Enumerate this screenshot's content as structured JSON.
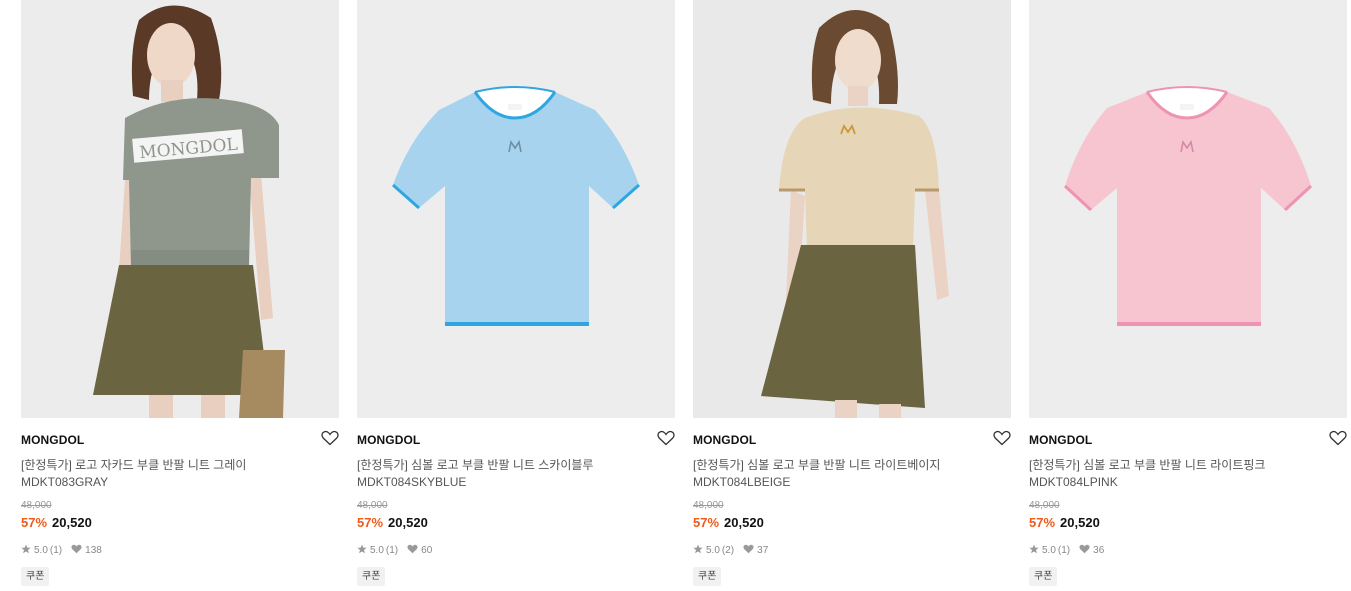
{
  "products": [
    {
      "image": "model-gray-knit-photo",
      "chest_text": "MONGDOL",
      "brand": "MONGDOL",
      "name": "[한정특가] 로고 자카드 부클 반팔 니트 그레이",
      "code": "MDKT083GRAY",
      "original_price": "48,000",
      "discount": "57%",
      "price": "20,520",
      "rating": "5.0",
      "review_count": "(1)",
      "likes": "138",
      "coupon_label": "쿠폰",
      "colors": {
        "top": "#8f978c",
        "trim": "#8f978c"
      }
    },
    {
      "image": "skyblue-knit-flat-photo",
      "brand": "MONGDOL",
      "name": "[한정특가] 심볼 로고 부클 반팔 니트 스카이블루",
      "code": "MDKT084SKYBLUE",
      "original_price": "48,000",
      "discount": "57%",
      "price": "20,520",
      "rating": "5.0",
      "review_count": "(1)",
      "likes": "60",
      "coupon_label": "쿠폰",
      "colors": {
        "top": "#a7d3ee",
        "trim": "#2fa6e0"
      }
    },
    {
      "image": "model-beige-knit-photo",
      "brand": "MONGDOL",
      "name": "[한정특가] 심볼 로고 부클 반팔 니트 라이트베이지",
      "code": "MDKT084LBEIGE",
      "original_price": "48,000",
      "discount": "57%",
      "price": "20,520",
      "rating": "5.0",
      "review_count": "(2)",
      "likes": "37",
      "coupon_label": "쿠폰",
      "colors": {
        "top": "#e7d5b8",
        "trim": "#b79a6c"
      }
    },
    {
      "image": "pink-knit-flat-photo",
      "brand": "MONGDOL",
      "name": "[한정특가] 심볼 로고 부클 반팔 니트 라이트핑크",
      "code": "MDKT084LPINK",
      "original_price": "48,000",
      "discount": "57%",
      "price": "20,520",
      "rating": "5.0",
      "review_count": "(1)",
      "likes": "36",
      "coupon_label": "쿠폰",
      "colors": {
        "top": "#f7c5cf",
        "trim": "#ee93b1"
      }
    }
  ],
  "icons": {
    "wishlist": "heart-outline-icon",
    "rating": "star-icon",
    "likes": "heart-filled-icon"
  },
  "theme": {
    "discount_color": "#f05a1a",
    "background": "#ffffff",
    "thumb_background": "#ededed"
  }
}
